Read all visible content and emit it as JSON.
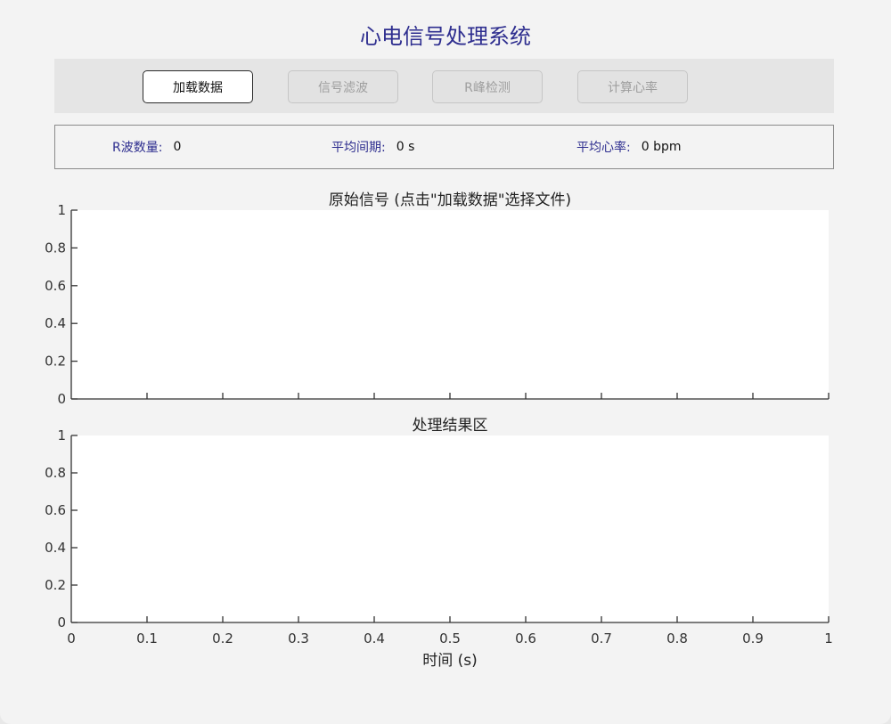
{
  "app": {
    "title": "心电信号处理系统"
  },
  "toolbar": {
    "buttons": [
      {
        "label": "加载数据",
        "enabled": true
      },
      {
        "label": "信号滤波",
        "enabled": false
      },
      {
        "label": "R峰检测",
        "enabled": false
      },
      {
        "label": "计算心率",
        "enabled": false
      }
    ]
  },
  "stats": {
    "r_count_label": "R波数量:",
    "r_count_value": "0",
    "avg_period_label": "平均间期:",
    "avg_period_value": "0 s",
    "avg_hr_label": "平均心率:",
    "avg_hr_value": "0 bpm"
  },
  "colors": {
    "title": "#2e2e8f",
    "label": "#2e2e8f"
  },
  "chart_data": [
    {
      "type": "line",
      "title": "原始信号 (点击\"加载数据\"选择文件)",
      "xlabel": "",
      "ylabel": "",
      "xlim": [
        0,
        1
      ],
      "ylim": [
        0,
        1
      ],
      "yticks": [
        "0",
        "0.2",
        "0.4",
        "0.6",
        "0.8",
        "1"
      ],
      "xticks": [],
      "series": [],
      "grid": false
    },
    {
      "type": "line",
      "title": "处理结果区",
      "xlabel": "时间 (s)",
      "ylabel": "",
      "xlim": [
        0,
        1
      ],
      "ylim": [
        0,
        1
      ],
      "yticks": [
        "0",
        "0.2",
        "0.4",
        "0.6",
        "0.8",
        "1"
      ],
      "xticks": [
        "0",
        "0.1",
        "0.2",
        "0.3",
        "0.4",
        "0.5",
        "0.6",
        "0.7",
        "0.8",
        "0.9",
        "1"
      ],
      "series": [],
      "grid": false
    }
  ]
}
